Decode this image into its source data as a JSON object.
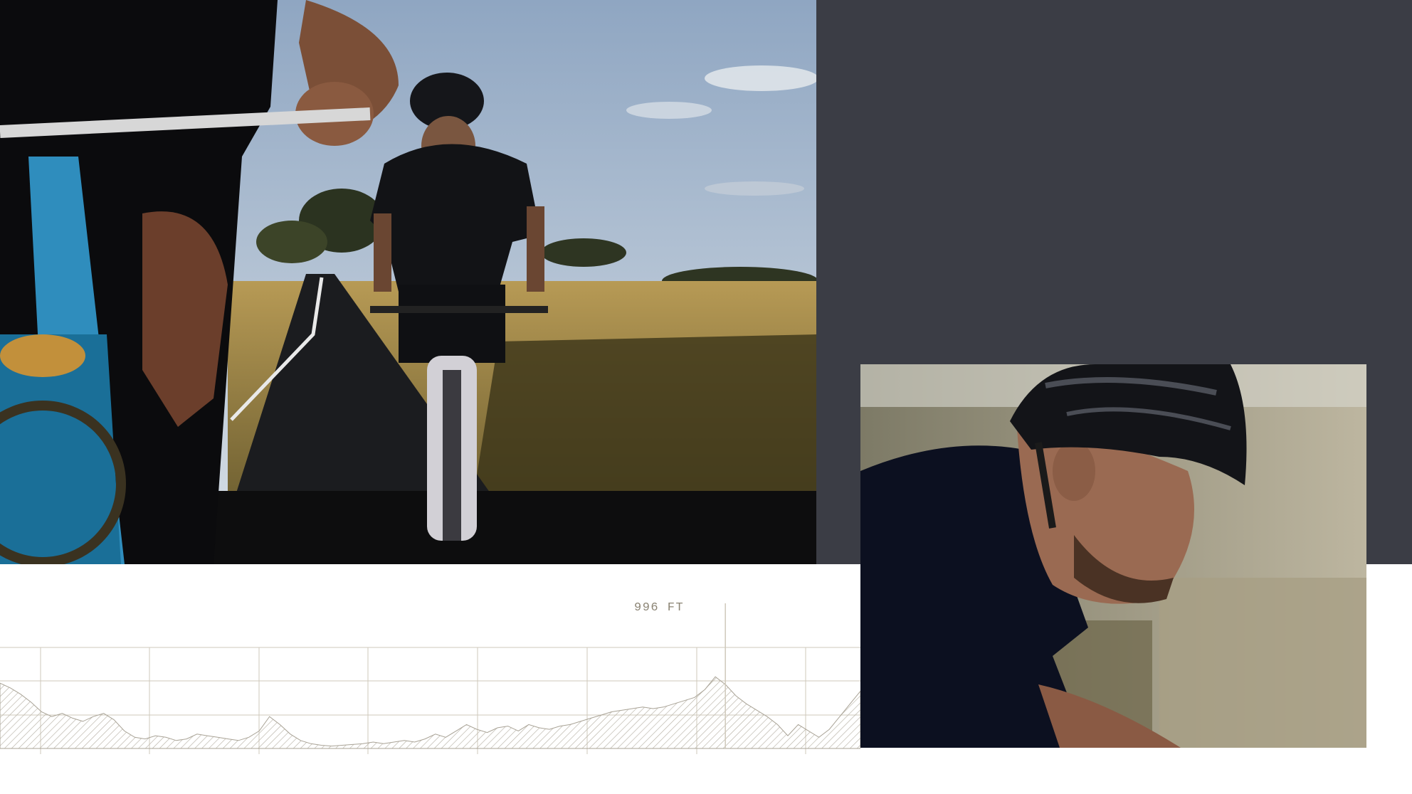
{
  "elevation_profile": {
    "peak_label": "996 FT",
    "peak_position_fraction": 0.843,
    "profile_levels": [
      0.82,
      0.76,
      0.68,
      0.58,
      0.46,
      0.4,
      0.44,
      0.38,
      0.34,
      0.4,
      0.44,
      0.36,
      0.22,
      0.14,
      0.12,
      0.16,
      0.14,
      0.1,
      0.12,
      0.18,
      0.16,
      0.14,
      0.12,
      0.1,
      0.14,
      0.22,
      0.4,
      0.3,
      0.18,
      0.1,
      0.06,
      0.04,
      0.03,
      0.04,
      0.05,
      0.06,
      0.08,
      0.06,
      0.08,
      0.1,
      0.08,
      0.12,
      0.18,
      0.14,
      0.22,
      0.3,
      0.24,
      0.2,
      0.26,
      0.28,
      0.22,
      0.3,
      0.26,
      0.24,
      0.28,
      0.3,
      0.34,
      0.38,
      0.42,
      0.46,
      0.48,
      0.5,
      0.52,
      0.5,
      0.52,
      0.56,
      0.6,
      0.64,
      0.74,
      0.9,
      0.8,
      0.66,
      0.56,
      0.48,
      0.4,
      0.3,
      0.16,
      0.3,
      0.22,
      0.14,
      0.24,
      0.4,
      0.56,
      0.72
    ]
  },
  "colors": {
    "dark_panel": "#3b3d45",
    "grid_line": "#cfc9bb",
    "hatch": "#b7b2a6",
    "label": "#8b8474"
  },
  "images": {
    "road_photo": "cyclist-on-country-road-photo",
    "portrait_photo": "cyclist-closeup-portrait-photo"
  }
}
